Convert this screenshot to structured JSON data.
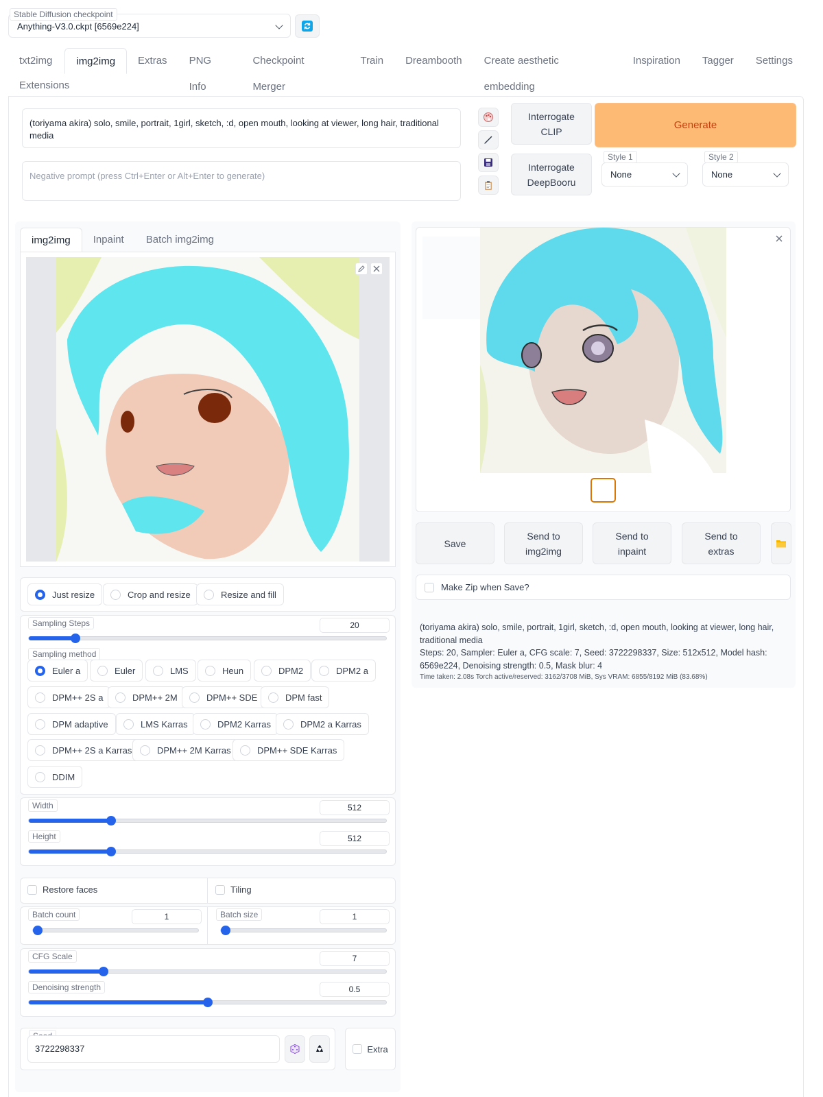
{
  "checkpoint": {
    "label": "Stable Diffusion checkpoint",
    "value": "Anything-V3.0.ckpt [6569e224]"
  },
  "main_tabs": [
    "txt2img",
    "img2img",
    "Extras",
    "PNG Info",
    "Checkpoint Merger",
    "Train",
    "Dreambooth",
    "Create aesthetic embedding",
    "Inspiration",
    "Tagger",
    "Settings",
    "Extensions"
  ],
  "prompt": {
    "value": "(toriyama akira) solo, smile, portrait, 1girl, sketch, :d, open mouth, looking at viewer, long hair, traditional media",
    "negative_placeholder": "Negative prompt (press Ctrl+Enter or Alt+Enter to generate)"
  },
  "interrogate_clip": "Interrogate\nCLIP",
  "interrogate_deepbooru": "Interrogate\nDeepBooru",
  "generate": "Generate",
  "styles": [
    {
      "label": "Style 1",
      "value": "None"
    },
    {
      "label": "Style 2",
      "value": "None"
    }
  ],
  "sub_tabs": [
    "img2img",
    "Inpaint",
    "Batch img2img"
  ],
  "resize_modes": [
    "Just resize",
    "Crop and resize",
    "Resize and fill"
  ],
  "sampling_steps": {
    "label": "Sampling Steps",
    "value": "20",
    "fraction": 0.13
  },
  "sampling_method": {
    "label": "Sampling method",
    "options": [
      "Euler a",
      "Euler",
      "LMS",
      "Heun",
      "DPM2",
      "DPM2 a",
      "DPM++ 2S a",
      "DPM++ 2M",
      "DPM++ SDE",
      "DPM fast",
      "DPM adaptive",
      "LMS Karras",
      "DPM2 Karras",
      "DPM2 a Karras",
      "DPM++ 2S a Karras",
      "DPM++ 2M Karras",
      "DPM++ SDE Karras",
      "DDIM"
    ],
    "selected": "Euler a"
  },
  "width": {
    "label": "Width",
    "value": "512",
    "fraction": 0.23
  },
  "height": {
    "label": "Height",
    "value": "512",
    "fraction": 0.23
  },
  "restore_faces": "Restore faces",
  "tiling": "Tiling",
  "batch_count": {
    "label": "Batch count",
    "value": "1",
    "fraction": 0.0
  },
  "batch_size": {
    "label": "Batch size",
    "value": "1",
    "fraction": 0.0
  },
  "cfg_scale": {
    "label": "CFG Scale",
    "value": "7",
    "fraction": 0.21
  },
  "denoising": {
    "label": "Denoising strength",
    "value": "0.5",
    "fraction": 0.5
  },
  "seed": {
    "label": "Seed",
    "value": "3722298337"
  },
  "extra": "Extra",
  "output_buttons": [
    "Save",
    "Send to\nimg2img",
    "Send to\ninpaint",
    "Send to\nextras"
  ],
  "make_zip": "Make Zip when Save?",
  "info": {
    "prompt": "(toriyama akira) solo, smile, portrait, 1girl, sketch, :d, open mouth, looking at viewer, long hair, traditional media",
    "params": "Steps: 20, Sampler: Euler a, CFG scale: 7, Seed: 3722298337, Size: 512x512, Model hash: 6569e224, Denoising strength: 0.5, Mask blur: 4",
    "time": "Time taken: 2.08s  Torch active/reserved: 3162/3708 MiB, Sys VRAM: 6855/8192 MiB (83.68%)"
  },
  "colors": {
    "accent": "#2563eb",
    "generate_bg": "#fdba74",
    "generate_text": "#c2410c"
  }
}
